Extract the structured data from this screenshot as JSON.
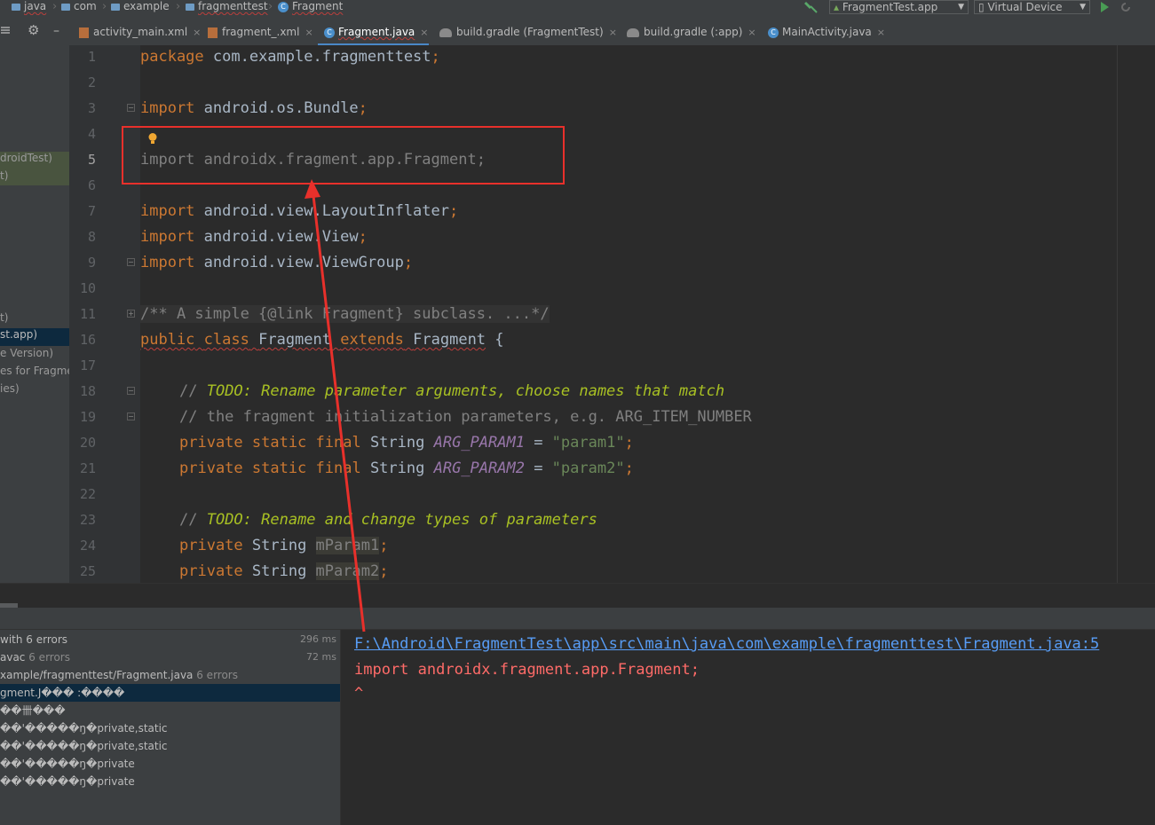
{
  "breadcrumb": {
    "items": [
      {
        "label": "java"
      },
      {
        "label": "com"
      },
      {
        "label": "example"
      },
      {
        "label": "fragmenttest"
      },
      {
        "label": "Fragment"
      }
    ],
    "run_config": "FragmentTest.app",
    "device": "Virtual Device"
  },
  "tabs": [
    {
      "label": "activity_main.xml",
      "close": "×"
    },
    {
      "label": "fragment_.xml",
      "close": "×"
    },
    {
      "label": "Fragment.java",
      "close": "×"
    },
    {
      "label": "build.gradle (FragmentTest)",
      "close": "×"
    },
    {
      "label": "build.gradle (:app)",
      "close": "×"
    },
    {
      "label": "MainActivity.java",
      "close": "×"
    }
  ],
  "project_panel": {
    "lines": [
      "droidTest)",
      "t)",
      "t)",
      "st.app)",
      "e Version)",
      "es for Fragme",
      "ies)"
    ]
  },
  "editor": {
    "line_numbers": [
      "1",
      "2",
      "3",
      "4",
      "5",
      "6",
      "7",
      "8",
      "9",
      "10",
      "11",
      "16",
      "17",
      "18",
      "19",
      "20",
      "21",
      "22",
      "23",
      "24",
      "25"
    ],
    "code": {
      "l1_kw": "package",
      "l1_rest": " com.example.fragmenttest",
      "l1_semi": ";",
      "l3_kw": "import",
      "l3_rest": " android.os.Bundle",
      "l3_semi": ";",
      "l5_text": "import androidx.fragment.app.Fragment;",
      "l7_kw": "import",
      "l7_rest": " android.view.LayoutInflater",
      "l7_semi": ";",
      "l8_kw": "import",
      "l8_rest": " android.view.View",
      "l8_semi": ";",
      "l9_kw": "import",
      "l9_rest": " android.view.ViewGroup",
      "l9_semi": ";",
      "l11_doc": "/** A simple {@link Fragment} subclass. ...*/",
      "l16_kw1": "public",
      "l16_kw2": "class",
      "l16_name": "Fragment",
      "l16_kw3": "extends",
      "l16_super": "Fragment",
      "l16_brace": " {",
      "l18_prefix": "// ",
      "l18_todo": "TODO: Rename parameter arguments, choose names that match",
      "l19_comment": "// the fragment initialization parameters, e.g. ARG_ITEM_NUMBER",
      "l20_kw": "private static final",
      "l20_type": " String ",
      "l20_const": "ARG_PARAM1",
      "l20_eq": " = ",
      "l20_str": "\"param1\"",
      "l20_semi": ";",
      "l21_kw": "private static final",
      "l21_type": " String ",
      "l21_const": "ARG_PARAM2",
      "l21_eq": " = ",
      "l21_str": "\"param2\"",
      "l21_semi": ";",
      "l23_prefix": "// ",
      "l23_todo": "TODO: Rename and change types of parameters",
      "l24_kw": "private",
      "l24_type": " String ",
      "l24_field": "mParam1",
      "l24_semi": ";",
      "l25_kw": "private",
      "l25_type": " String ",
      "l25_field": "mParam2",
      "l25_semi": ";"
    }
  },
  "build_tree": [
    {
      "text": "with 6 errors",
      "time": "296 ms"
    },
    {
      "text": "avac",
      "extra": "6 errors",
      "time": "72 ms"
    },
    {
      "text": "xample/fragmenttest/Fragment.java",
      "extra": "6 errors"
    },
    {
      "text": "gment.J��� :����"
    },
    {
      "text": "��卌���"
    },
    {
      "text": "��'�����ŋ�private,static"
    },
    {
      "text": "��'�����ŋ�private,static"
    },
    {
      "text": "��'�����ŋ�private"
    },
    {
      "text": "��'�����ŋ�private"
    }
  ],
  "build_output": {
    "path": "F:\\Android\\FragmentTest\\app\\src\\main\\java\\com\\example\\fragmenttest\\Fragment.java:5",
    "line": "import androidx.fragment.app.Fragment;",
    "caret": "^"
  },
  "colors": {
    "keyword": "#cc7832",
    "string": "#6a8759",
    "comment": "#808080",
    "todo": "#a8c023",
    "annotation_red": "#e8302b",
    "link": "#589df6",
    "error": "#ff6b68"
  }
}
